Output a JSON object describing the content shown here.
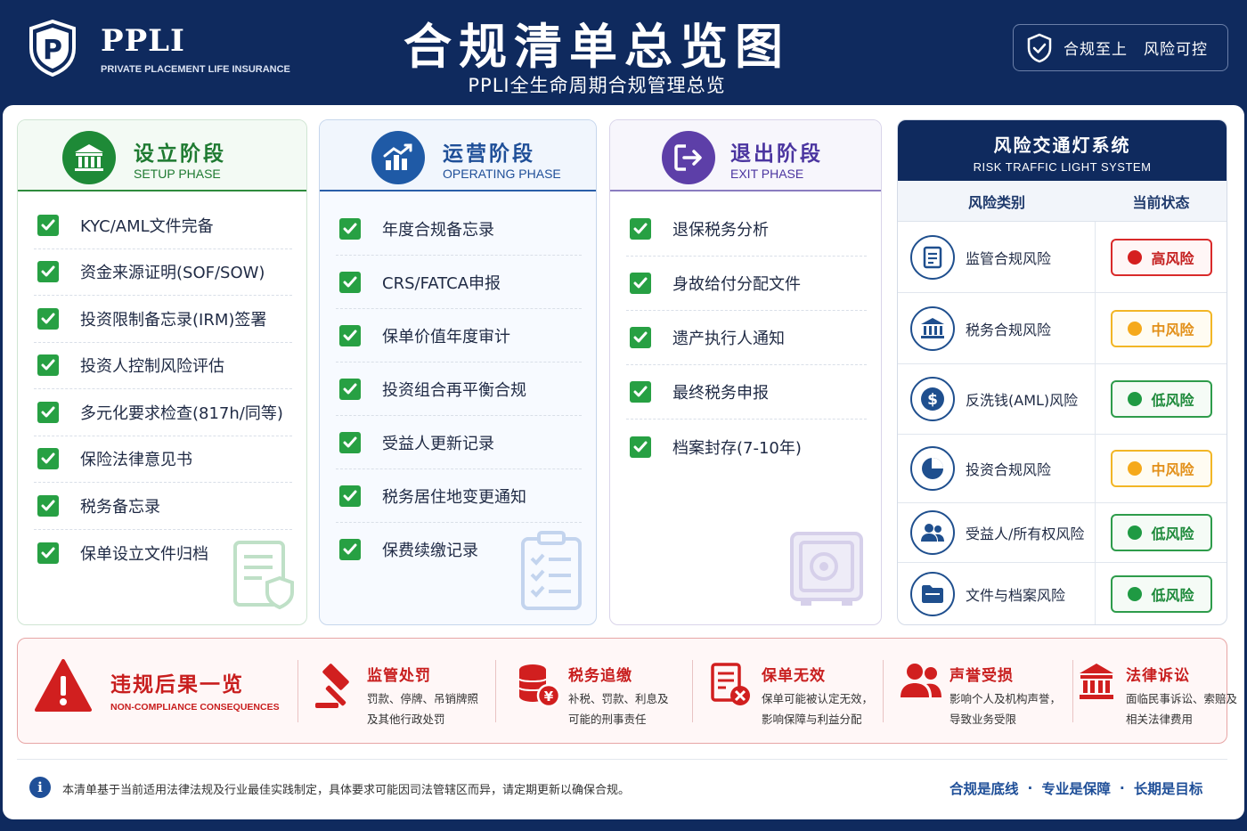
{
  "header": {
    "brand": "PPLI",
    "brand_sub": "PRIVATE PLACEMENT LIFE INSURANCE",
    "title": "合规清单总览图",
    "subtitle": "PPLI全生命周期合规管理总览",
    "motto": "合规至上　风险可控"
  },
  "phases": {
    "setup": {
      "title": "设立阶段",
      "en": "SETUP PHASE",
      "items": [
        "KYC/AML文件完备",
        "资金来源证明(SOF/SOW)",
        "投资限制备忘录(IRM)签署",
        "投资人控制风险评估",
        "多元化要求检查(817h/同等)",
        "保险法律意见书",
        "税务备忘录",
        "保单设立文件归档"
      ]
    },
    "operating": {
      "title": "运营阶段",
      "en": "OPERATING PHASE",
      "items": [
        "年度合规备忘录",
        "CRS/FATCA申报",
        "保单价值年度审计",
        "投资组合再平衡合规",
        "受益人更新记录",
        "税务居住地变更通知",
        "保费续缴记录"
      ]
    },
    "exit": {
      "title": "退出阶段",
      "en": "EXIT PHASE",
      "items": [
        "退保税务分析",
        "身故给付分配文件",
        "遗产执行人通知",
        "最终税务申报",
        "档案封存(7-10年)"
      ]
    }
  },
  "traffic": {
    "title": "风险交通灯系统",
    "en": "RISK TRAFFIC LIGHT SYSTEM",
    "col_category": "风险类别",
    "col_status": "当前状态",
    "rows": [
      {
        "label": "监管合规风险",
        "status": "高风险",
        "level": "high",
        "icon": "document-icon"
      },
      {
        "label": "税务合规风险",
        "status": "中风险",
        "level": "mid",
        "icon": "bank-icon"
      },
      {
        "label": "反洗钱(AML)风险",
        "status": "低风险",
        "level": "low",
        "icon": "dollar-icon"
      },
      {
        "label": "投资合规风险",
        "status": "中风险",
        "level": "mid",
        "icon": "pie-chart-icon"
      },
      {
        "label": "受益人/所有权风险",
        "status": "低风险",
        "level": "low",
        "icon": "people-icon"
      },
      {
        "label": "文件与档案风险",
        "status": "低风险",
        "level": "low",
        "icon": "folder-icon"
      }
    ]
  },
  "consequences": {
    "title": "违规后果一览",
    "en": "NON-COMPLIANCE CONSEQUENCES",
    "items": [
      {
        "name": "监管处罚",
        "line1": "罚款、停牌、吊销牌照",
        "line2": "及其他行政处罚",
        "icon": "gavel-icon"
      },
      {
        "name": "税务追缴",
        "line1": "补税、罚款、利息及",
        "line2": "可能的刑事责任",
        "icon": "coins-icon"
      },
      {
        "name": "保单无效",
        "line1": "保单可能被认定无效，",
        "line2": "影响保障与利益分配",
        "icon": "invalid-document-icon"
      },
      {
        "name": "声誉受损",
        "line1": "影响个人及机构声誉，",
        "line2": "导致业务受限",
        "icon": "people-icon"
      },
      {
        "name": "法律诉讼",
        "line1": "面临民事诉讼、索赔及",
        "line2": "相关法律费用",
        "icon": "courthouse-icon"
      }
    ]
  },
  "footer": {
    "note": "本清单基于当前适用法律法规及行业最佳实践制定，具体要求可能因司法管辖区而异，请定期更新以确保合规。",
    "slogan": [
      "合规是底线",
      "专业是保障",
      "长期是目标"
    ],
    "separator": "·"
  },
  "colors": {
    "navy": "#0f2a5e",
    "green": "#1e8a37",
    "blue": "#1f5aa6",
    "purple": "#5d3fa8",
    "red": "#c81e1e",
    "amber": "#f5a91b"
  }
}
